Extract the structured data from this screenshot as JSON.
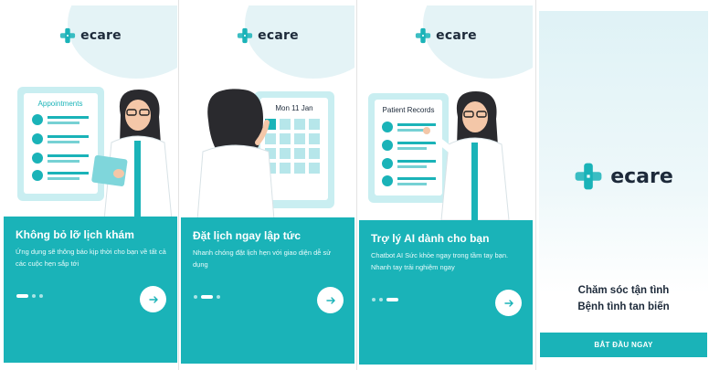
{
  "brand": {
    "name": "ecare",
    "logo_icon": "medical-cross-logo-icon",
    "color": "#1ab3b8"
  },
  "screens": [
    {
      "illustration_label": "Appointments",
      "title": "Không bỏ lỡ lịch khám",
      "description": "Ứng dụng sẽ thông báo kịp thời cho bạn về tất cả các cuộc hẹn sắp tới",
      "active_dot": 0
    },
    {
      "illustration_label": "Mon 11 Jan",
      "title": "Đặt lịch ngay lập tức",
      "description": "Nhanh chóng đặt lịch hẹn với giao diện dễ sử dụng",
      "active_dot": 1
    },
    {
      "illustration_label": "Patient Records",
      "title": "Trợ lý AI dành cho bạn",
      "description": "Chatbot AI Sức khỏe ngay trong tầm tay bạn. Nhanh tay trải nghiệm ngay",
      "active_dot": 2
    }
  ],
  "splash": {
    "slogan_line1": "Chăm sóc tận tình",
    "slogan_line2": "Bệnh tình tan biến",
    "start_button": "BẮT ĐẦU NGAY"
  },
  "colors": {
    "primary": "#1ab3b8",
    "dark_text": "#1d2a3a",
    "light_bg": "#e4f3f6"
  },
  "icons": {
    "next": "arrow-right-icon"
  }
}
